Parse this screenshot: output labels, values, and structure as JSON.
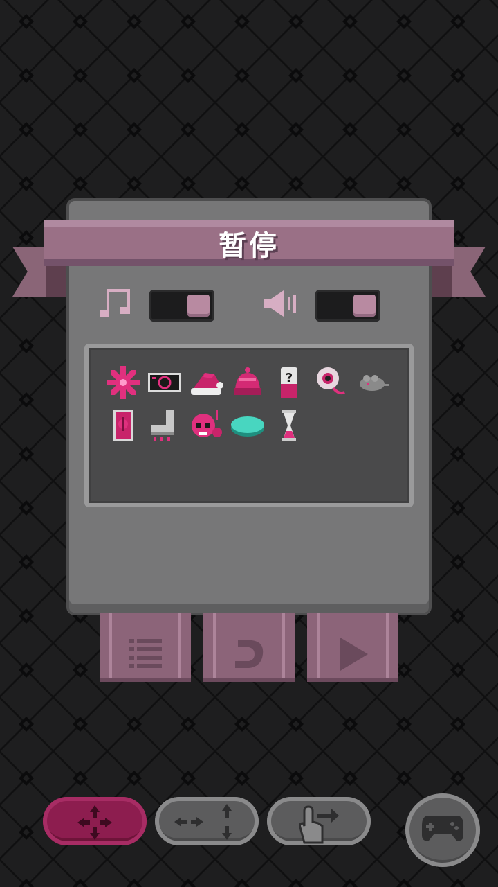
{
  "pause_menu": {
    "title": "暂停",
    "music_toggle": {
      "icon": "music-note-icon",
      "state": "on"
    },
    "sound_toggle": {
      "icon": "speaker-icon",
      "state": "on"
    }
  },
  "inventory": {
    "items": [
      {
        "name": "pink-spiked-sun-item"
      },
      {
        "name": "black-gadget-card-item"
      },
      {
        "name": "santa-hat-item"
      },
      {
        "name": "pink-beanie-item"
      },
      {
        "name": "mystery-can-item"
      },
      {
        "name": "eyeball-item"
      },
      {
        "name": "grey-mouse-item"
      },
      {
        "name": "pink-card-item"
      },
      {
        "name": "grey-boot-item"
      },
      {
        "name": "pink-skull-item"
      },
      {
        "name": "teal-button-item"
      },
      {
        "name": "hourglass-item"
      }
    ]
  },
  "menu_buttons": [
    {
      "name": "list-menu-button",
      "icon": "list-icon"
    },
    {
      "name": "restart-button",
      "icon": "restart-arrow-icon"
    },
    {
      "name": "resume-button",
      "icon": "play-icon"
    }
  ],
  "control_modes": [
    {
      "name": "dpad-control-mode",
      "icon": "four-way-arrows-icon",
      "selected": true
    },
    {
      "name": "split-arrows-control-mode",
      "icon": "split-arrows-icon",
      "selected": false
    },
    {
      "name": "swipe-control-mode",
      "icon": "hand-swipe-icon",
      "selected": false
    },
    {
      "name": "gamepad-control-mode",
      "icon": "gamepad-icon",
      "selected": false
    }
  ],
  "colors": {
    "background": "#1e1e1f",
    "panel": "#777778",
    "ribbon": "#9a7086",
    "accent_pink": "#e0307e",
    "active_control": "#8d1d4f"
  }
}
